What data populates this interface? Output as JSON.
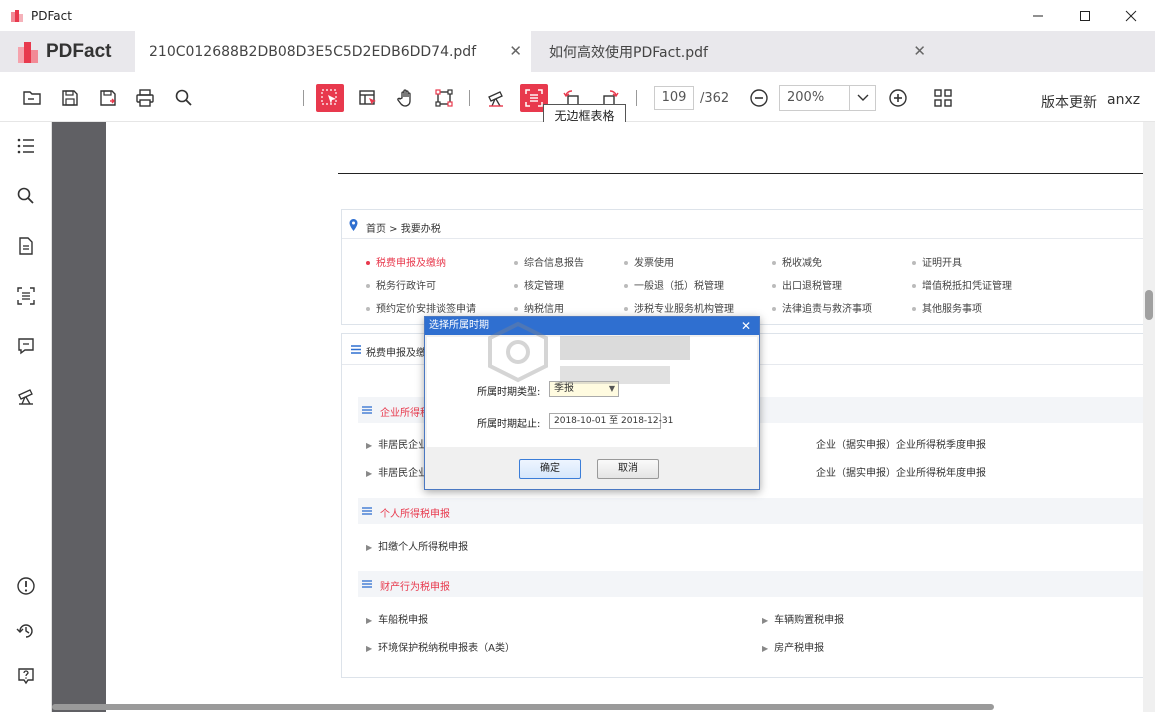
{
  "window": {
    "title": "PDFact"
  },
  "brand": {
    "logo_text": "PDFact",
    "accent": "#e8394d"
  },
  "tabs": [
    {
      "label": "210C012688B2DB08D3E5C5D2EDB6DD74.pdf",
      "active": true
    },
    {
      "label": "如何高效使用PDFact.pdf",
      "active": false
    }
  ],
  "toolbar": {
    "page_current": "109",
    "page_total": "/362",
    "zoom": "200%",
    "update_label": "版本更新",
    "user_label": "anxz",
    "tooltip": "无边框表格"
  },
  "document": {
    "breadcrumb": "首页 > 我要办税",
    "service_grid": [
      [
        "税费申报及缴纳",
        "综合信息报告",
        "发票使用",
        "税收减免",
        "证明开具"
      ],
      [
        "税务行政许可",
        "核定管理",
        "一般退（抵）税管理",
        "出口退税管理",
        "增值税抵扣凭证管理"
      ],
      [
        "预约定价安排谈签申请",
        "纳税信用",
        "涉税专业服务机构管理",
        "法律追责与救济事项",
        "其他服务事项"
      ]
    ],
    "section_title": "税费申报及缴纳",
    "groups": {
      "corp": {
        "title": "企业所得税申报",
        "items": [
          "非居民企业企业所得税",
          "非居民企业(核定征收",
          "企业（据实申报）企业所得税季度申报",
          "企业（据实申报）企业所得税年度申报"
        ]
      },
      "personal": {
        "title": "个人所得税申报",
        "items": [
          "扣缴个人所得税申报"
        ]
      },
      "property": {
        "title": "财产行为税申报",
        "items": [
          "车船税申报",
          "车辆购置税申报",
          "环境保护税纳税申报表（A类）",
          "房产税申报"
        ]
      }
    }
  },
  "dialog": {
    "title": "选择所属时期",
    "period_type_label": "所属时期类型:",
    "period_type_value": "季报",
    "period_range_label": "所属时期起止:",
    "period_range_value": "2018-10-01 至 2018-12-31",
    "ok": "确定",
    "cancel": "取消"
  }
}
